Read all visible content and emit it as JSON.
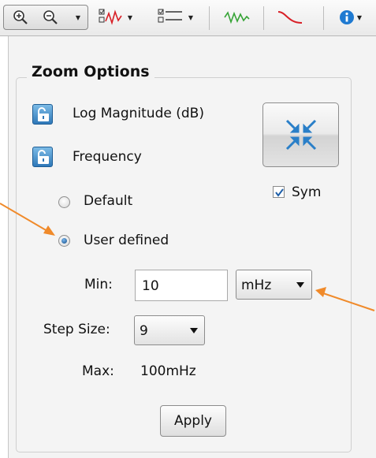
{
  "toolbar": {
    "icons": [
      "zoom-in-icon",
      "zoom-out-icon",
      "trace-options-icon",
      "list-options-icon",
      "green-signal-icon",
      "red-curve-icon",
      "info-icon"
    ]
  },
  "zoom_options": {
    "title": "Zoom Options",
    "log_magnitude_label": "Log Magnitude (dB)",
    "frequency_label": "Frequency",
    "default_label": "Default",
    "user_defined_label": "User defined",
    "selected_mode": "User defined",
    "sym_label": "Sym",
    "sym_checked": true,
    "min_label": "Min:",
    "min_value": "10",
    "unit_selected": "mHz",
    "step_size_label": "Step Size:",
    "step_size_selected": "9",
    "max_label": "Max:",
    "max_value": "100mHz",
    "apply_label": "Apply"
  },
  "colors": {
    "accent": "#f08a2a",
    "lock_blue": "#2f78b8",
    "panel_bg": "#f3f3f3"
  }
}
